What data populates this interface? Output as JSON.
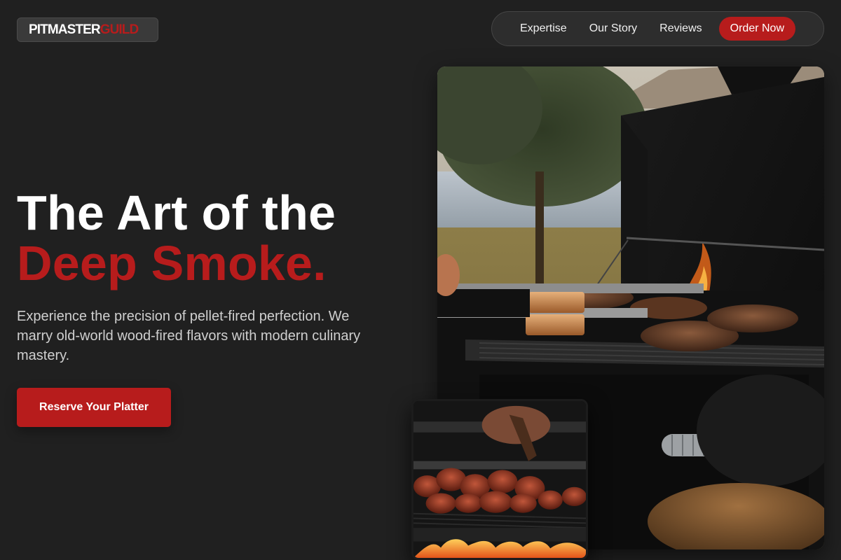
{
  "brand": {
    "part1": "PITMASTER",
    "part2": "GUILD"
  },
  "nav": {
    "items": [
      {
        "label": "Expertise"
      },
      {
        "label": "Our Story"
      },
      {
        "label": "Reviews"
      }
    ],
    "cta_label": "Order Now"
  },
  "hero": {
    "title_line1": "The Art of the",
    "title_line2": "Deep Smoke.",
    "description": "Experience the precision of pellet-fired perfection. We marry old-world wood-fired flavors with modern culinary mastery.",
    "cta_label": "Reserve Your Platter"
  },
  "colors": {
    "background": "#202020",
    "accent": "#b71c1c",
    "text": "#ffffff",
    "muted_text": "#cfcfcf"
  }
}
